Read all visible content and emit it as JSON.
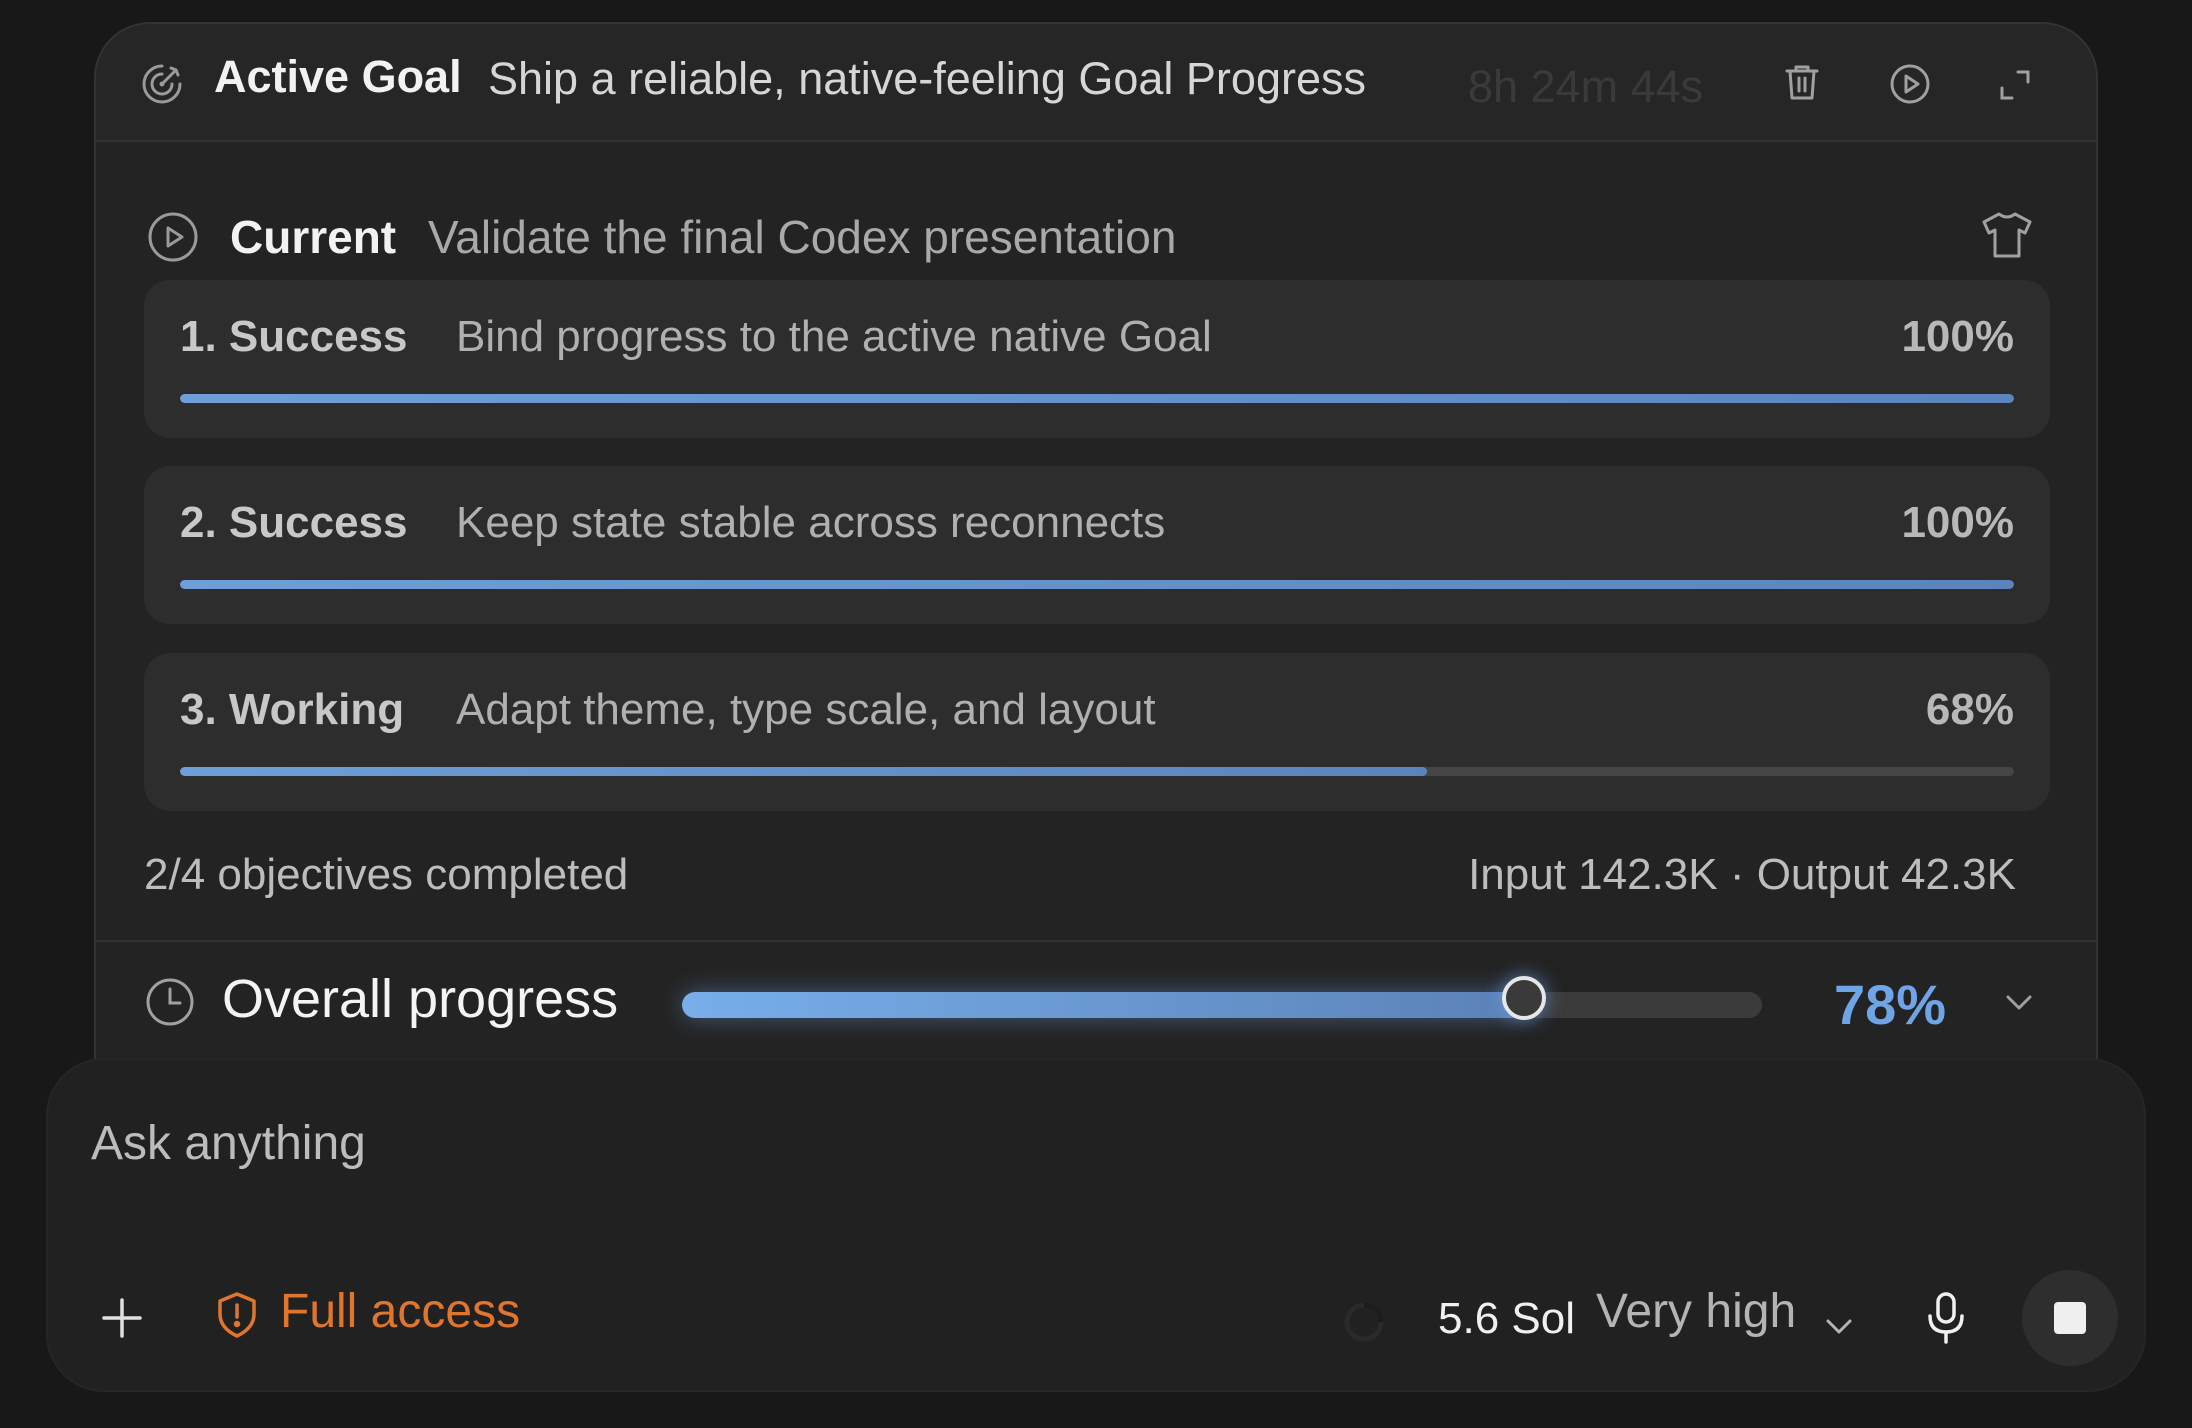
{
  "goal": {
    "title": "Active Goal",
    "description": "Ship a reliable, native-feeling Goal Progress",
    "timer": "8h 24m 44s",
    "icons": [
      "goal-icon",
      "trash-icon",
      "play-icon",
      "expand-icon"
    ]
  },
  "current": {
    "label": "Current",
    "text": "Validate the final Codex presentation",
    "icons": [
      "play-icon",
      "shirt-icon"
    ]
  },
  "objectives": [
    {
      "number": "1. Success",
      "text": "Bind progress to the active native Goal",
      "percent_label": "100%",
      "progress": 1.0
    },
    {
      "number": "2. Success",
      "text": "Keep state stable across reconnects",
      "percent_label": "100%",
      "progress": 1.0
    },
    {
      "number": "3. Working",
      "text": "Adapt theme, type scale, and layout",
      "percent_label": "68%",
      "progress": 0.68
    }
  ],
  "summary": {
    "completed": "2/4 objectives completed",
    "tokens": "Input 142.3K · Output 42.3K"
  },
  "overall": {
    "label": "Overall progress",
    "percent_label": "78%",
    "progress": 0.78,
    "icons": [
      "clock-icon",
      "chevron-down-icon"
    ]
  },
  "composer": {
    "placeholder": "Ask anything",
    "access": "Full access",
    "model": "5.6 Sol",
    "effort": "Very high",
    "icons": [
      "plus-icon",
      "shield-alert-icon",
      "spinner-icon",
      "chevron-down-icon",
      "microphone-icon",
      "stop-icon"
    ]
  },
  "colors": {
    "background": "#181818",
    "panel": "#232323",
    "card": "#2d2d2d",
    "progress": "#6e9fd8",
    "accent_percent": "#6fa4e6",
    "access": "#e0752e"
  }
}
